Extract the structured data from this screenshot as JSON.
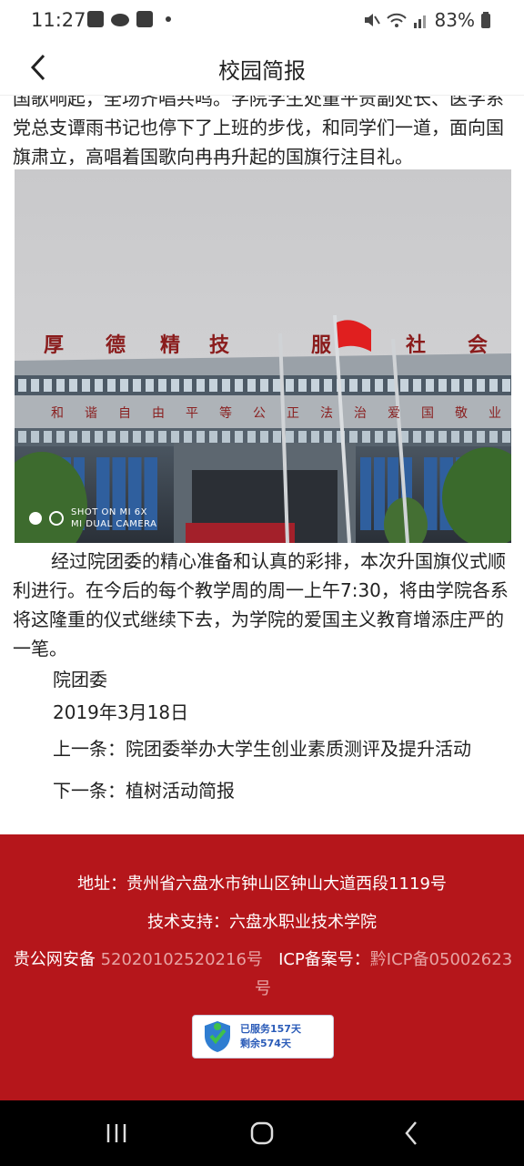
{
  "status_bar": {
    "time": "11:27",
    "battery": "83%"
  },
  "header": {
    "title": "校园简报"
  },
  "article": {
    "para_top": "国歌响起，全场齐唱共鸣。学院学生处董平贵副处长、医学系党总支谭雨书记也停下了上班的步伐，和同学们一道，面向国旗肃立，高唱着国歌向冉冉升起的国旗行注目礼。",
    "photo": {
      "watermark_line1": "SHOT ON MI 6X",
      "watermark_line2": "MI DUAL CAMERA",
      "sign_chars": [
        "厚",
        "德",
        "精",
        "技",
        "服",
        "社",
        "会"
      ],
      "banner_chars": [
        "和",
        "谐",
        "自",
        "由",
        "平",
        "等",
        "公",
        "正",
        "法",
        "治",
        "爱",
        "国",
        "敬",
        "业"
      ]
    },
    "para_bottom": "经过院团委的精心准备和认真的彩排，本次升国旗仪式顺利进行。在今后的每个教学周的周一上午7:30，将由学院各系将这隆重的仪式继续下去，为学院的爱国主义教育增添庄严的一笔。",
    "author": "院团委",
    "date": "2019年3月18日",
    "prev_label": "上一条：",
    "prev_title": "院团委举办大学生创业素质测评及提升活动",
    "next_label": "下一条：",
    "next_title": "植树活动简报"
  },
  "footer": {
    "address": "地址：贵州省六盘水市钟山区钟山大道西段1119号",
    "support": "技术支持：六盘水职业技术学院",
    "police_label": "贵公网安备",
    "police_number": "52020102520216号",
    "icp_label": "ICP备案号：",
    "icp_number": "黔ICP备05002623号",
    "badge_line1": "已服务157天",
    "badge_line2": "剩余574天"
  },
  "colors": {
    "footer_bg": "#b5161b",
    "accent_blue": "#2a5bb8"
  },
  "icons": [
    "back-arrow-icon",
    "image-icon",
    "cloud-icon",
    "checkbox-icon",
    "mute-icon",
    "wifi-icon",
    "signal-icon",
    "battery-icon",
    "shield-icon",
    "recents-icon",
    "home-icon",
    "back-nav-icon"
  ]
}
